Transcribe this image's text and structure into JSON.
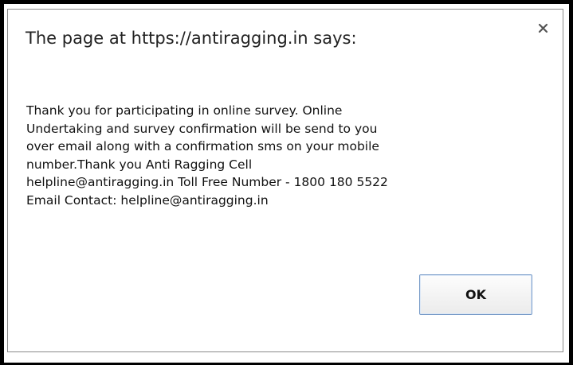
{
  "dialog": {
    "title": "The page at https://antiragging.in says:",
    "message": "Thank you for participating in online survey. Online\nUndertaking and survey confirmation will be send to you\nover email along with a confirmation sms on your mobile\nnumber.Thank you Anti Ragging Cell\nhelpline@antiragging.in Toll Free Number - 1800 180 5522\nEmail Contact: helpline@antiragging.in",
    "ok_label": "OK",
    "close_icon": "close-icon"
  },
  "colors": {
    "frame": "#000000",
    "dialog_border": "#8a8a8a",
    "button_border": "#7a9dc9",
    "text": "#222222"
  }
}
